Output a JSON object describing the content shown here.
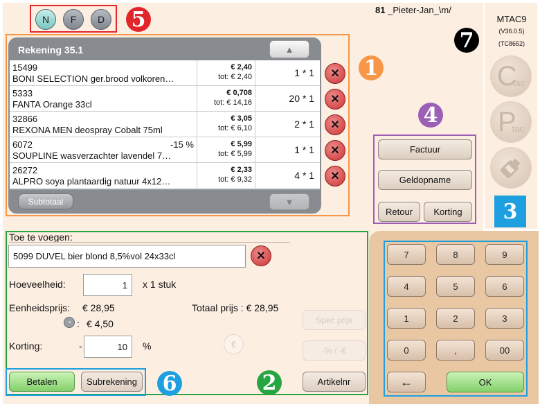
{
  "header": {
    "user_label": "81",
    "user_name": "_Pieter-Jan_\\m/"
  },
  "terminal": {
    "name": "MTAC9",
    "version": "(V36.0.5)",
    "code": "(TC8652)"
  },
  "mode_buttons": [
    "N",
    "F",
    "D"
  ],
  "badges": [
    "1",
    "2",
    "3",
    "4",
    "5",
    "6",
    "7"
  ],
  "receipt": {
    "title": "Rekening 35.1",
    "subtotal_label": "Subtotaal",
    "rows": [
      {
        "code": "15499",
        "name": "BONI SELECTION ger.brood volkoren…",
        "discount": "",
        "price": "€ 2,40",
        "total": "tot: € 2,40",
        "qty": "1 * 1"
      },
      {
        "code": "5333",
        "name": "FANTA Orange 33cl",
        "discount": "",
        "price": "€ 0,708",
        "total": "tot: € 14,16",
        "qty": "20 * 1"
      },
      {
        "code": "32866",
        "name": "REXONA MEN deospray Cobalt 75ml",
        "discount": "",
        "price": "€ 3,05",
        "total": "tot: € 6,10",
        "qty": "2 * 1"
      },
      {
        "code": "6072",
        "name": "SOUPLINE wasverzachter lavendel 7…",
        "discount": "-15 %",
        "price": "€ 5,99",
        "total": "tot: € 5,99",
        "qty": "1 * 1"
      },
      {
        "code": "26272",
        "name": "ALPRO soya plantaardig natuur 4x12…",
        "discount": "",
        "price": "€ 2,33",
        "total": "tot: € 9,32",
        "qty": "4 * 1"
      }
    ]
  },
  "actions": {
    "factuur": "Factuur",
    "geldopname": "Geldopname",
    "retour": "Retour",
    "korting": "Korting"
  },
  "add_item": {
    "title": "Toe te voegen:",
    "item_value": "5099 DUVEL bier blond 8,5%vol 24x33cl",
    "quantity_label": "Hoeveelheid:",
    "quantity_value": "1",
    "quantity_unit": "x 1 stuk",
    "unit_price_label": "Eenheidsprijs:",
    "unit_price_value": "€ 28,95",
    "total_price_label": "Totaal prijs : € 28,95",
    "deposit_value": "€ 4,50",
    "deposit_colon": ":",
    "discount_label": "Korting:",
    "discount_minus": "-",
    "discount_value": "10",
    "discount_unit": "%",
    "spec_price": "Spec prijs",
    "pct_euro": "-% / -€",
    "euro_symbol": "€",
    "article_nr": "Artikelnr"
  },
  "pay": {
    "betalen": "Betalen",
    "subrekening": "Subrekening"
  },
  "side_icons": {
    "c_letter": "C",
    "c_sub": "tac",
    "p_letter": "P",
    "p_sub": "tac"
  },
  "keypad": {
    "keys": [
      "7",
      "8",
      "9",
      "4",
      "5",
      "6",
      "1",
      "2",
      "3",
      "0",
      ",",
      "00"
    ],
    "backspace": "←",
    "ok": "OK"
  }
}
